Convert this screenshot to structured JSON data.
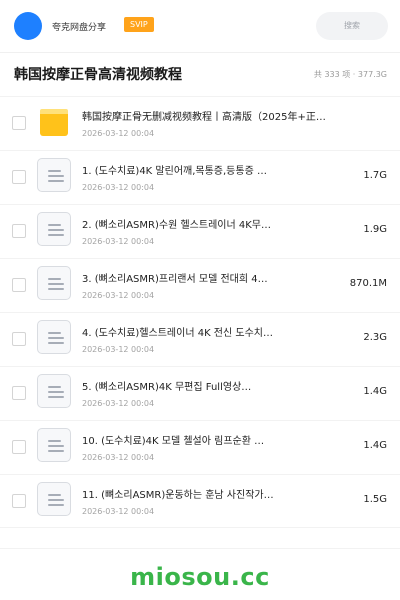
{
  "header": {
    "app_name": "夸克网盘分享",
    "badge": "SVIP",
    "search_placeholder": "搜索"
  },
  "page": {
    "title": "韩国按摩正骨高清视频教程",
    "summary": "共 333 项 · 377.3G"
  },
  "files": [
    {
      "type": "folder",
      "name": "韩国按摩正骨无删减视频教程丨高清版（2025年+正…",
      "date": "2026-03-12 00:04",
      "size": ""
    },
    {
      "type": "file",
      "name": "1. (도수치료)4K 말린어깨,목통증,등통증 …",
      "date": "2026-03-12 00:04",
      "size": "1.7G"
    },
    {
      "type": "file",
      "name": "2. (뼈소리ASMR)수원 헬스트레이너 4K무…",
      "date": "2026-03-12 00:04",
      "size": "1.9G"
    },
    {
      "type": "file",
      "name": "3. (뼈소리ASMR)프리랜서 모델 전대희 4…",
      "date": "2026-03-12 00:04",
      "size": "870.1M"
    },
    {
      "type": "file",
      "name": "4. (도수치료)헬스트레이너 4K 전신 도수치…",
      "date": "2026-03-12 00:04",
      "size": "2.3G"
    },
    {
      "type": "file",
      "name": "5. (뼈소리ASMR)4K 무편집 Full영상…",
      "date": "2026-03-12 00:04",
      "size": "1.4G"
    },
    {
      "type": "file",
      "name": "10. (도수치료)4K 모델 첼설아 림프순환 …",
      "date": "2026-03-12 00:04",
      "size": "1.4G"
    },
    {
      "type": "file",
      "name": "11. (뼈소리ASMR)운동하는 훈남 사진작가…",
      "date": "2026-03-12 00:04",
      "size": "1.5G"
    }
  ],
  "watermark": "miosou.cc",
  "colors": {
    "brand": "#1e80ff",
    "svip": "#ffa31a",
    "folder": "#ffc21a",
    "watermark": "#3ab54a"
  }
}
